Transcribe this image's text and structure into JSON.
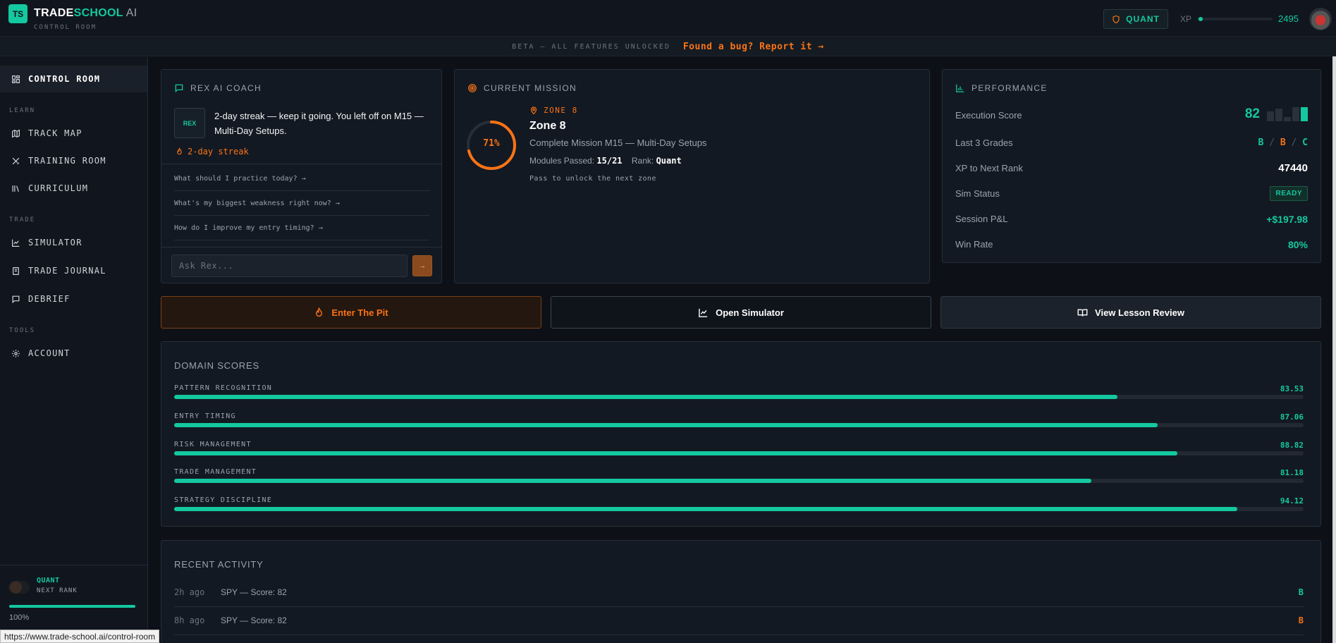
{
  "header": {
    "logo_initials": "TS",
    "brand_part1": "TRADE",
    "brand_part2": "SCHOOL",
    "brand_part3": " AI",
    "subtitle": "CONTROL ROOM",
    "rank_badge": "QUANT",
    "xp_label": "XP",
    "xp_value": "2495",
    "xp_progress": 0.02
  },
  "beta": {
    "text": "BETA — ALL FEATURES UNLOCKED",
    "bug_link": "Found a bug? Report it →"
  },
  "sidebar": {
    "active": "CONTROL ROOM",
    "sections": {
      "learn": "LEARN",
      "trade": "TRADE",
      "tools": "TOOLS"
    },
    "items": [
      {
        "label": "CONTROL ROOM",
        "icon": "grid-icon"
      },
      {
        "label": "TRACK MAP",
        "icon": "map-icon"
      },
      {
        "label": "TRAINING ROOM",
        "icon": "swords-icon"
      },
      {
        "label": "CURRICULUM",
        "icon": "library-icon"
      },
      {
        "label": "SIMULATOR",
        "icon": "chart-line-icon"
      },
      {
        "label": "TRADE JOURNAL",
        "icon": "notebook-icon"
      },
      {
        "label": "DEBRIEF",
        "icon": "chat-icon"
      },
      {
        "label": "ACCOUNT",
        "icon": "gear-icon"
      }
    ],
    "footer": {
      "rank": "QUANT",
      "next_rank_label": "NEXT RANK",
      "progress_pct": "100%",
      "progress": 1.0
    }
  },
  "coach": {
    "title": "REX AI COACH",
    "avatar_label": "REX",
    "message": "2-day streak — keep it going. You left off on M15 — Multi-Day Setups.",
    "streak": "2-day streak",
    "suggestions": [
      "What should I practice today? →",
      "What's my biggest weakness right now? →",
      "How do I improve my entry timing? →"
    ],
    "input_placeholder": "Ask Rex...",
    "send_label": "→"
  },
  "mission": {
    "title": "CURRENT MISSION",
    "progress_pct": "71%",
    "progress": 0.71,
    "zone_tag": "ZONE 8",
    "zone_title": "Zone 8",
    "description": "Complete Mission M15 — Multi-Day Setups",
    "modules_label": "Modules Passed:",
    "modules_value": "15/21",
    "rank_label": "Rank:",
    "rank_value": "Quant",
    "note": "Pass to unlock the next zone"
  },
  "performance": {
    "title": "PERFORMANCE",
    "rows": {
      "execution_label": "Execution Score",
      "execution_value": "82",
      "grades_label": "Last 3 Grades",
      "grades": [
        "B",
        "B",
        "C"
      ],
      "grade_sep": "/",
      "xp_label": "XP to Next Rank",
      "xp_value": "47440",
      "sim_label": "Sim Status",
      "sim_value": "READY",
      "pnl_label": "Session P&L",
      "pnl_value": "+$197.98",
      "win_label": "Win Rate",
      "win_value": "80%"
    }
  },
  "actions": {
    "pit": "Enter The Pit",
    "simulator": "Open Simulator",
    "lesson": "View Lesson Review"
  },
  "domain_scores": {
    "title": "DOMAIN SCORES",
    "items": [
      {
        "label": "PATTERN RECOGNITION",
        "value": "83.53",
        "fraction": 0.8353
      },
      {
        "label": "ENTRY TIMING",
        "value": "87.06",
        "fraction": 0.8706
      },
      {
        "label": "RISK MANAGEMENT",
        "value": "88.82",
        "fraction": 0.8882
      },
      {
        "label": "TRADE MANAGEMENT",
        "value": "81.18",
        "fraction": 0.8118
      },
      {
        "label": "STRATEGY DISCIPLINE",
        "value": "94.12",
        "fraction": 0.9412
      }
    ]
  },
  "recent_activity": {
    "title": "RECENT ACTIVITY",
    "items": [
      {
        "time": "2h ago",
        "desc": "SPY — Score: 82",
        "grade": "B"
      },
      {
        "time": "8h ago",
        "desc": "SPY — Score: 82",
        "grade": "B"
      }
    ]
  },
  "colors": {
    "accent": "#14c8a0",
    "warn": "#f97316",
    "bg": "#0d1117"
  },
  "status_url": "https://www.trade-school.ai/control-room"
}
